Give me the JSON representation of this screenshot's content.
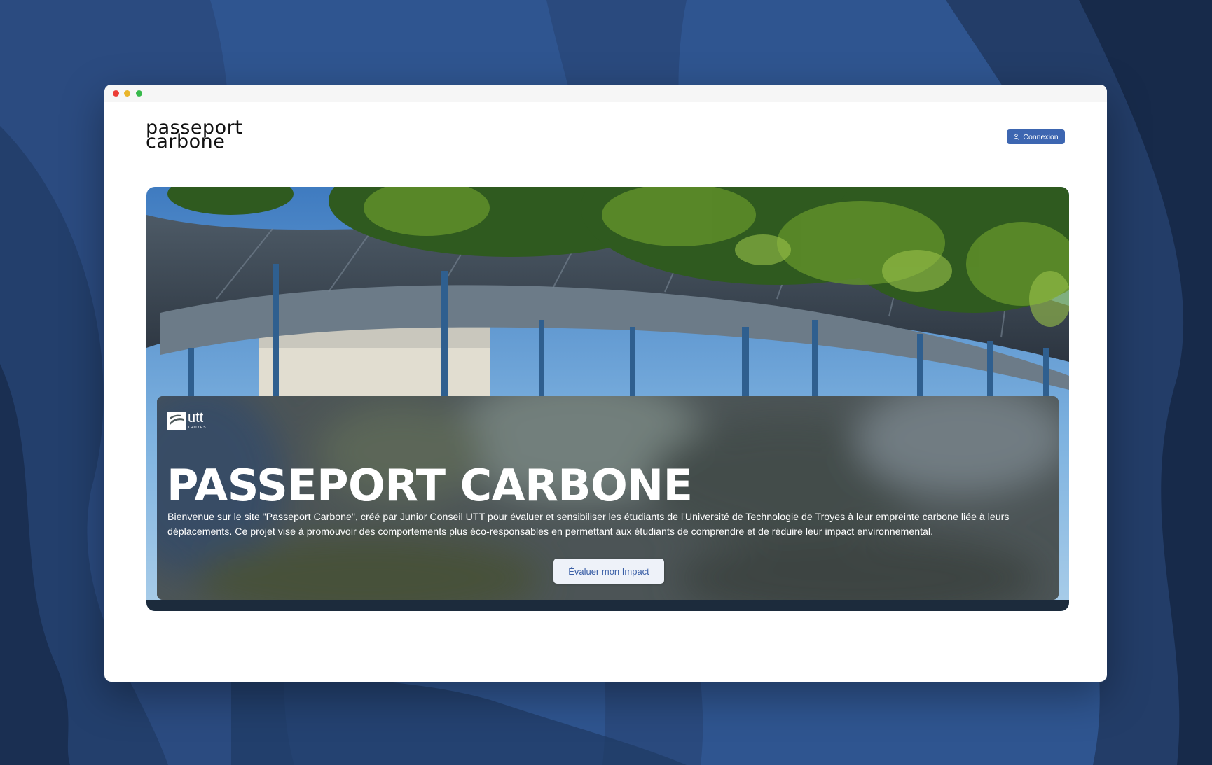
{
  "window": {
    "controls": [
      "close",
      "minimize",
      "maximize"
    ]
  },
  "header": {
    "logo_line1": "passeport",
    "logo_line2": "carbone",
    "login_label": "Connexion",
    "login_icon": "user-icon"
  },
  "hero": {
    "org_logo": "utt",
    "org_logo_sub": "TROYES",
    "title": "PASSEPORT CARBONE",
    "description": "Bienvenue sur le site \"Passeport Carbone\", créé par Junior Conseil UTT pour évaluer et sensibiliser les étudiants de l'Université de Technologie de Troyes à leur empreinte carbone liée à leurs déplacements. Ce projet vise à promouvoir des comportements plus éco-responsables en permettant aux étudiants de comprendre et de réduire leur impact environnemental.",
    "cta_label": "Évaluer mon Impact"
  },
  "colors": {
    "accent": "#3d66b1",
    "background": "#2b4f86",
    "cta_text": "#3a5fa6"
  }
}
